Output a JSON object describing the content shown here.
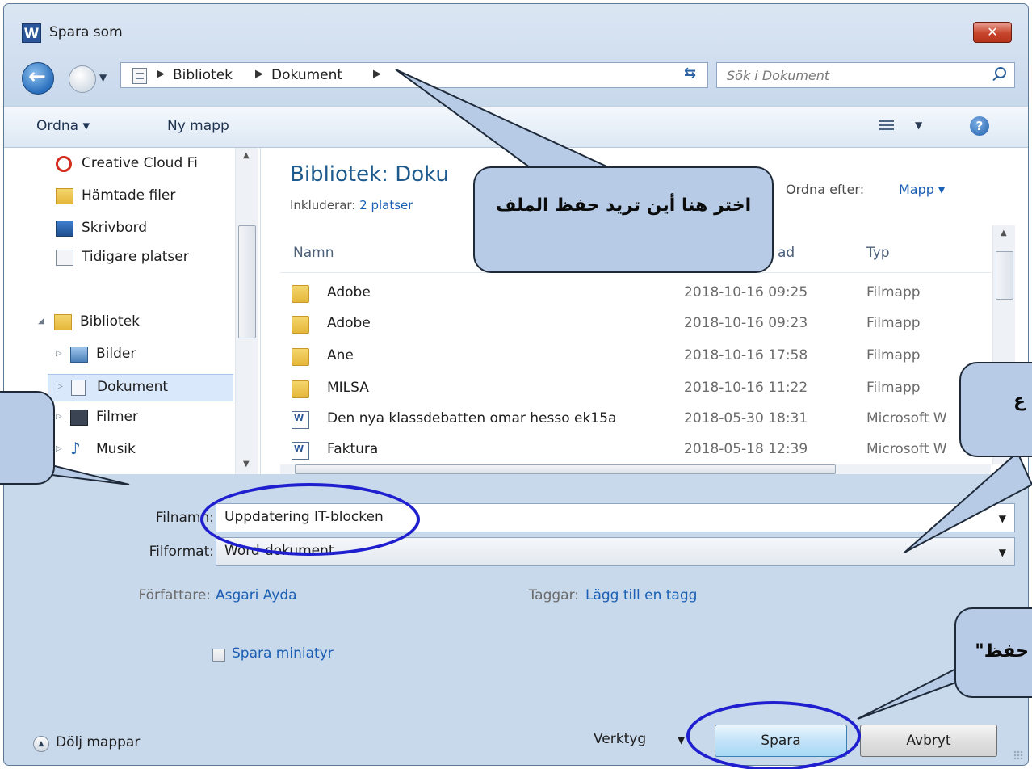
{
  "window": {
    "title": "Spara som",
    "app_icon": "W",
    "close": "✕"
  },
  "nav": {
    "breadcrumbs": [
      "Bibliotek",
      "Dokument"
    ],
    "search_placeholder": "Sök i Dokument"
  },
  "toolbar": {
    "organize": "Ordna ▾",
    "new_folder": "Ny mapp",
    "help": "?"
  },
  "sidebar": {
    "items": [
      {
        "label": "Creative Cloud Fi",
        "icon": "creative-cloud-icon"
      },
      {
        "label": "Hämtade filer",
        "icon": "downloads-icon"
      },
      {
        "label": "Skrivbord",
        "icon": "desktop-icon"
      },
      {
        "label": "Tidigare platser",
        "icon": "recent-places-icon"
      },
      {
        "label": "Bibliotek",
        "icon": "library-icon"
      },
      {
        "label": "Bilder",
        "icon": "pictures-icon"
      },
      {
        "label": "Dokument",
        "icon": "documents-icon"
      },
      {
        "label": "Filmer",
        "icon": "videos-icon"
      },
      {
        "label": "Musik",
        "icon": "music-icon"
      }
    ]
  },
  "library": {
    "title": "Bibliotek: Doku",
    "includes_label": "Inkluderar:",
    "includes_value": "2 platser",
    "sort_label": "Ordna efter:",
    "sort_value": "Mapp ▾"
  },
  "columns": {
    "name": "Namn",
    "date": "ad",
    "type": "Typ"
  },
  "files": [
    {
      "name": "Adobe",
      "date": "2018-10-16 09:25",
      "type": "Filmapp",
      "kind": "folder"
    },
    {
      "name": "Adobe",
      "date": "2018-10-16 09:23",
      "type": "Filmapp",
      "kind": "folder"
    },
    {
      "name": "Ane",
      "date": "2018-10-16 17:58",
      "type": "Filmapp",
      "kind": "folder"
    },
    {
      "name": "MILSA",
      "date": "2018-10-16 11:22",
      "type": "Filmapp",
      "kind": "folder"
    },
    {
      "name": "Den nya klassdebatten omar hesso ek15a",
      "date": "2018-05-30 18:31",
      "type": "Microsoft W",
      "kind": "word"
    },
    {
      "name": "Faktura",
      "date": "2018-05-18 12:39",
      "type": "Microsoft W",
      "kind": "word"
    }
  ],
  "form": {
    "filename_label": "Filnamn:",
    "filename_value": "Uppdatering IT-blocken",
    "format_label": "Filformat:",
    "format_value": "Word-dokument",
    "author_label": "Författare:",
    "author_value": "Asgari Ayda",
    "tags_label": "Taggar:",
    "tags_value": "Lägg till en tagg",
    "thumbnail_label": "Spara miniatyr"
  },
  "footer": {
    "hide_folders": "Dölj mappar",
    "tools": "Verktyg",
    "save": "Spara",
    "cancel": "Avbryt"
  },
  "annotations": {
    "location_callout": "اختر هنا أين تريد حفظ الملف",
    "right_callout_fragment": "ع",
    "save_callout_fragment": "حفظ\"",
    "outline_color": "#1f1fd0",
    "callout_fill": "#b7cbe6"
  }
}
